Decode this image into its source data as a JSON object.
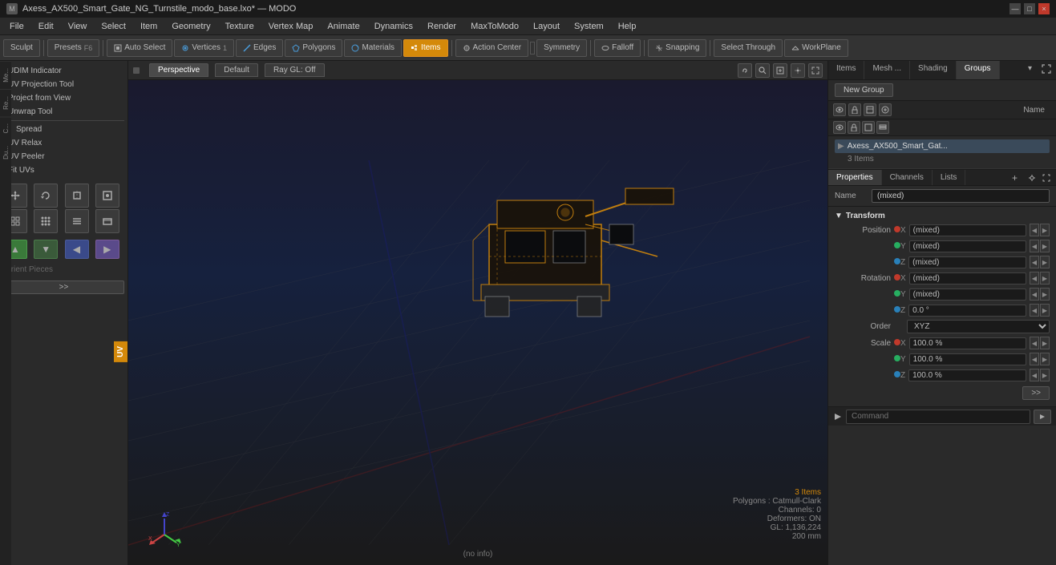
{
  "window": {
    "title": "Axess_AX500_Smart_Gate_NG_Turnstile_modo_base.lxo* — MODO",
    "close_label": "×",
    "min_label": "—",
    "max_label": "□"
  },
  "menu": {
    "items": [
      "File",
      "Edit",
      "View",
      "Select",
      "Item",
      "Geometry",
      "Texture",
      "Vertex Map",
      "Animate",
      "Dynamics",
      "Render",
      "MaxToModo",
      "Layout",
      "System",
      "Help"
    ]
  },
  "toolbar": {
    "sculpt_label": "Sculpt",
    "presets_label": "Presets",
    "presets_key": "F6",
    "auto_select_label": "Auto Select",
    "vertices_label": "Vertices",
    "vertices_val": "1",
    "edges_label": "Edges",
    "edges_val": "",
    "polygons_label": "Polygons",
    "materials_label": "Materials",
    "items_label": "Items",
    "action_center_label": "Action Center",
    "symmetry_label": "Symmetry",
    "falloff_label": "Falloff",
    "snapping_label": "Snapping",
    "select_through_label": "Select Through",
    "workplane_label": "WorkPlane"
  },
  "left_tools": {
    "items": [
      "UDIM Indicator",
      "UV Projection Tool",
      "Project from View",
      "Unwrap Tool",
      "Spread",
      "UV Relax",
      "UV Peeler",
      "Fit UVs"
    ],
    "orient_label": "Orient Pieces",
    "expand_label": ">>",
    "uv_label": "UV"
  },
  "vert_tabs": {
    "tabs": [
      "Me...",
      "Re...",
      "C...",
      "Du..."
    ]
  },
  "viewport": {
    "tab_perspective": "Perspective",
    "tab_default": "Default",
    "tab_raygl": "Ray GL: Off",
    "status_items": "3 Items",
    "status_polygons": "Polygons : Catmull-Clark",
    "status_channels": "Channels: 0",
    "status_deformers": "Deformers: ON",
    "status_gl": "GL: 1,136,224",
    "status_size": "200 mm",
    "status_no_info": "(no info)"
  },
  "right_panel": {
    "tabs": [
      "Items",
      "Mesh ...",
      "Shading",
      "Groups"
    ],
    "active_tab": "Groups",
    "new_group_label": "New Group",
    "name_col_label": "Name",
    "group_name": "Axess_AX500_Smart_Gat...",
    "group_items_label": "3 Items"
  },
  "properties": {
    "tabs": [
      "Properties",
      "Channels",
      "Lists"
    ],
    "add_label": "+",
    "name_label": "Name",
    "name_value": "(mixed)",
    "transform_label": "▼ Transform",
    "position_label": "Position",
    "rotation_label": "Rotation",
    "scale_label": "Scale",
    "order_label": "Order",
    "axes": {
      "x": "X",
      "y": "Y",
      "z": "Z"
    },
    "position_x": "(mixed)",
    "position_y": "(mixed)",
    "position_z": "(mixed)",
    "rotation_x": "(mixed)",
    "rotation_y": "(mixed)",
    "rotation_z": "0.0 °",
    "order_value": "XYZ",
    "scale_x": "100.0 %",
    "scale_y": "100.0 %",
    "scale_z": "100.0 %"
  },
  "command_bar": {
    "placeholder": "Command",
    "go_label": "▶"
  }
}
